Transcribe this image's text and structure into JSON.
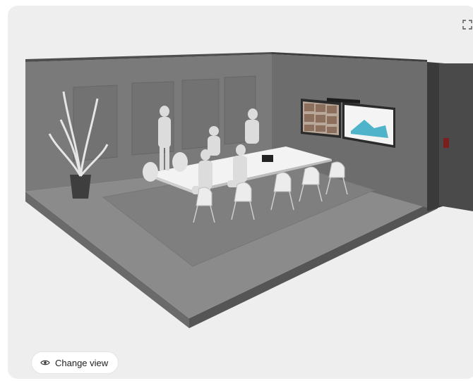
{
  "viewer": {
    "expand_icon": "expand-fullscreen-icon",
    "change_view_label": "Change view",
    "change_view_icon": "eye-icon"
  },
  "colors": {
    "background": "#eeeeee",
    "button_bg": "#ffffff",
    "text": "#222222"
  }
}
